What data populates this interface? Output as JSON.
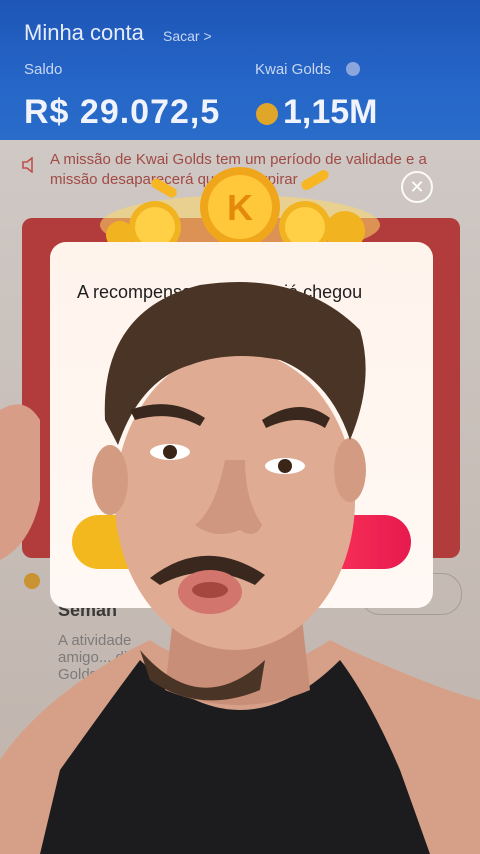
{
  "header": {
    "title": "Minha conta",
    "withdraw_link": "Sacar >",
    "balance_label": "Saldo",
    "balance_value": "R$ 29.072,5",
    "gold_label": "Kwai Golds",
    "gold_value": "1,15M"
  },
  "notice": {
    "text": "A missão de Kwai Golds tem um período de validade e a missão desaparecerá quando expirar"
  },
  "section": {
    "title": "Seman",
    "description": "A atividade amigo... dias! C... Golds"
  },
  "modal": {
    "heading": "A recompensa do convite já chegou",
    "close_label": "✕"
  },
  "colors": {
    "header_blue": "#2566c8",
    "modal_bg": "#fff6f0",
    "gold_button": "#f3b81e",
    "red_button": "#e7194e"
  }
}
